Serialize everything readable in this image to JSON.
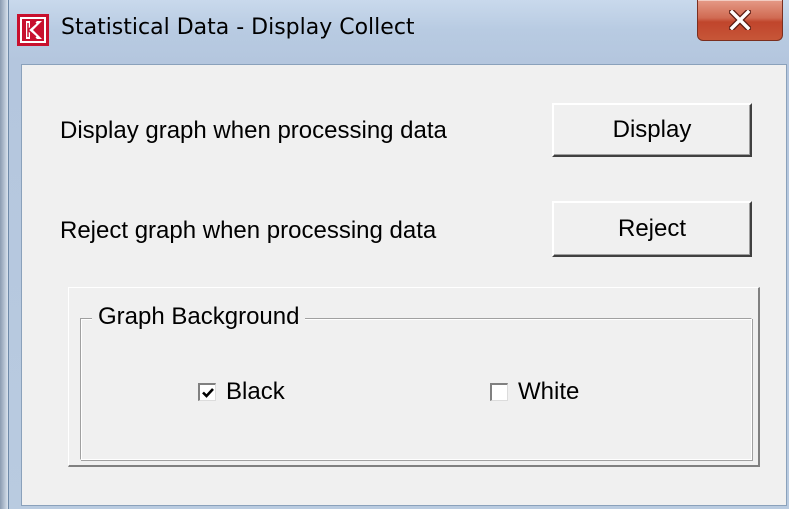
{
  "window": {
    "title": "Statistical Data - Display Collect",
    "icon": "k-logo-icon",
    "close_icon": "close-icon",
    "close_color": "#c75638"
  },
  "rows": [
    {
      "label": "Display graph when processing data",
      "button": "Display"
    },
    {
      "label": "Reject graph when processing data",
      "button": "Reject"
    }
  ],
  "group": {
    "legend": "Graph Background",
    "options": [
      {
        "label": "Black",
        "checked": true
      },
      {
        "label": "White",
        "checked": false
      }
    ]
  }
}
